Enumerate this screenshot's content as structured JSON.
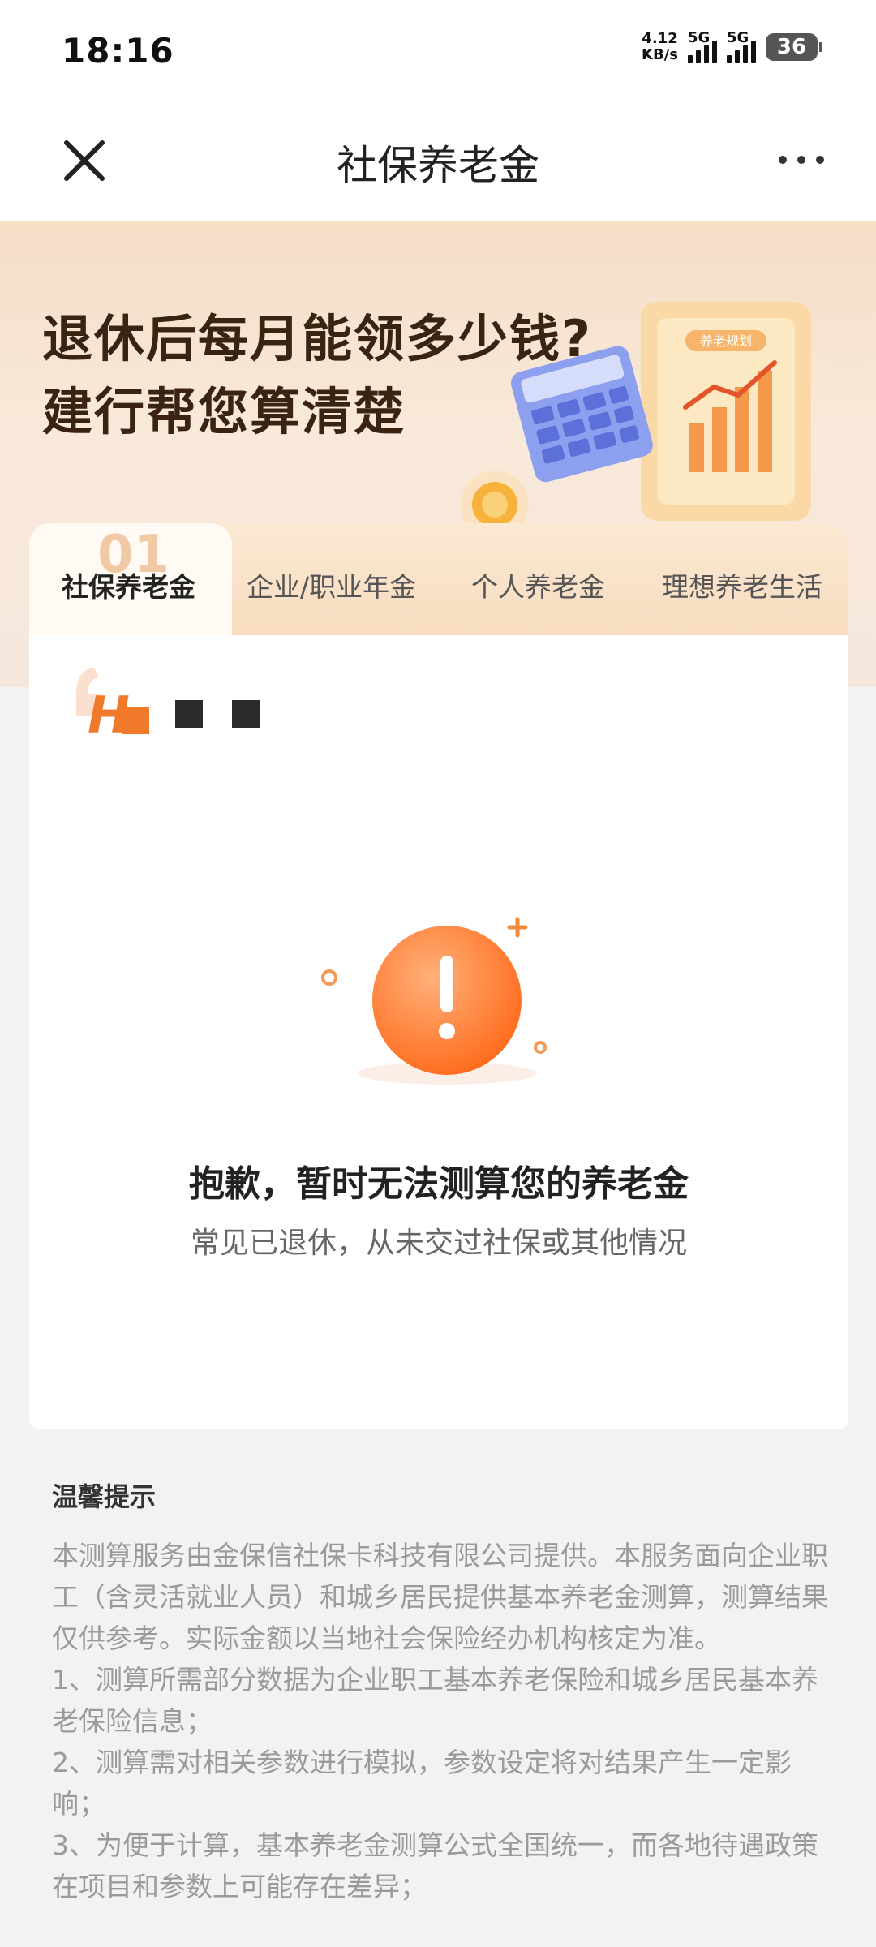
{
  "status_bar": {
    "time": "18:16",
    "net_speed_value": "4.12",
    "net_speed_unit": "KB/s",
    "signal1_label": "5G",
    "signal2_label": "5G",
    "battery": "36"
  },
  "nav": {
    "title": "社保养老金",
    "close_icon": "close-icon",
    "more_icon": "more-icon"
  },
  "banner": {
    "line1": "退休后每月能领多少钱?",
    "line2": "建行帮您算清楚",
    "illustration_label": "养老规划"
  },
  "tabs": {
    "active_number": "01",
    "items": [
      {
        "label": "社保养老金",
        "active": true
      },
      {
        "label": "企业/职业年金",
        "active": false
      },
      {
        "label": "个人养老金",
        "active": false
      },
      {
        "label": "理想养老生活",
        "active": false
      }
    ]
  },
  "card": {
    "error_title": "抱歉，暂时无法测算您的养老金",
    "error_subtitle": "常见已退休，从未交过社保或其他情况"
  },
  "tips": {
    "title": "温馨提示",
    "paragraphs": [
      "本测算服务由金保信社保卡科技有限公司提供。本服务面向企业职工（含灵活就业人员）和城乡居民提供基本养老金测算，测算结果仅供参考。实际金额以当地社会保险经办机构核定为准。",
      "1、测算所需部分数据为企业职工基本养老保险和城乡居民基本养老保险信息；",
      "2、测算需对相关参数进行模拟，参数设定将对结果产生一定影响；",
      "3、为便于计算，基本养老金测算公式全国统一，而各地待遇政策在项目和参数上可能存在差异；"
    ]
  },
  "colors": {
    "accent_orange": "#ff7a2e",
    "banner_bg": "#f8e6d4",
    "text_primary": "#222222",
    "text_muted": "#9a9a9a"
  }
}
